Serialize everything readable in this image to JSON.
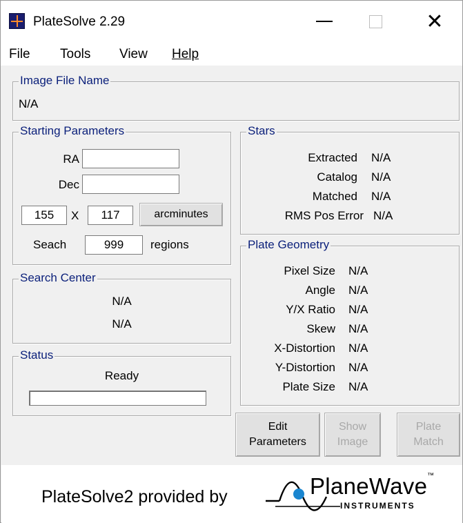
{
  "window": {
    "title": "PlateSolve 2.29"
  },
  "menu": [
    "File",
    "Tools",
    "View",
    "Help"
  ],
  "image_file": {
    "legend": "Image File Name",
    "value": "N/A"
  },
  "starting_params": {
    "legend": "Starting Parameters",
    "ra_label": "RA",
    "ra_value": "",
    "dec_label": "Dec",
    "dec_value": "",
    "width_value": "155",
    "times": "X",
    "height_value": "117",
    "units_button": "arcminutes",
    "search_label": "Seach",
    "search_value": "999",
    "regions_label": "regions"
  },
  "search_center": {
    "legend": "Search Center",
    "line1": "N/A",
    "line2": "N/A"
  },
  "status": {
    "legend": "Status",
    "text": "Ready",
    "progress": 0
  },
  "stars": {
    "legend": "Stars",
    "rows": [
      {
        "label": "Extracted",
        "value": "N/A"
      },
      {
        "label": "Catalog",
        "value": "N/A"
      },
      {
        "label": "Matched",
        "value": "N/A"
      },
      {
        "label": "RMS Pos Error",
        "value": "N/A"
      }
    ]
  },
  "plate_geometry": {
    "legend": "Plate Geometry",
    "rows": [
      {
        "label": "Pixel Size",
        "value": "N/A"
      },
      {
        "label": "Angle",
        "value": "N/A"
      },
      {
        "label": "Y/X Ratio",
        "value": "N/A"
      },
      {
        "label": "Skew",
        "value": "N/A"
      },
      {
        "label": "X-Distortion",
        "value": "N/A"
      },
      {
        "label": "Y-Distortion",
        "value": "N/A"
      },
      {
        "label": "Plate Size",
        "value": "N/A"
      }
    ]
  },
  "buttons": {
    "edit_line1": "Edit",
    "edit_line2": "Parameters",
    "show_line1": "Show",
    "show_line2": "Image",
    "plate_line1": "Plate",
    "plate_line2": "Match"
  },
  "footer": {
    "text": "PlateSolve2 provided by",
    "logo_main": "PlaneWave",
    "logo_tm": "™",
    "logo_sub": "INSTRUMENTS"
  },
  "colors": {
    "group_legend": "#0a1f7a",
    "logo_dot": "#1a86d0"
  }
}
